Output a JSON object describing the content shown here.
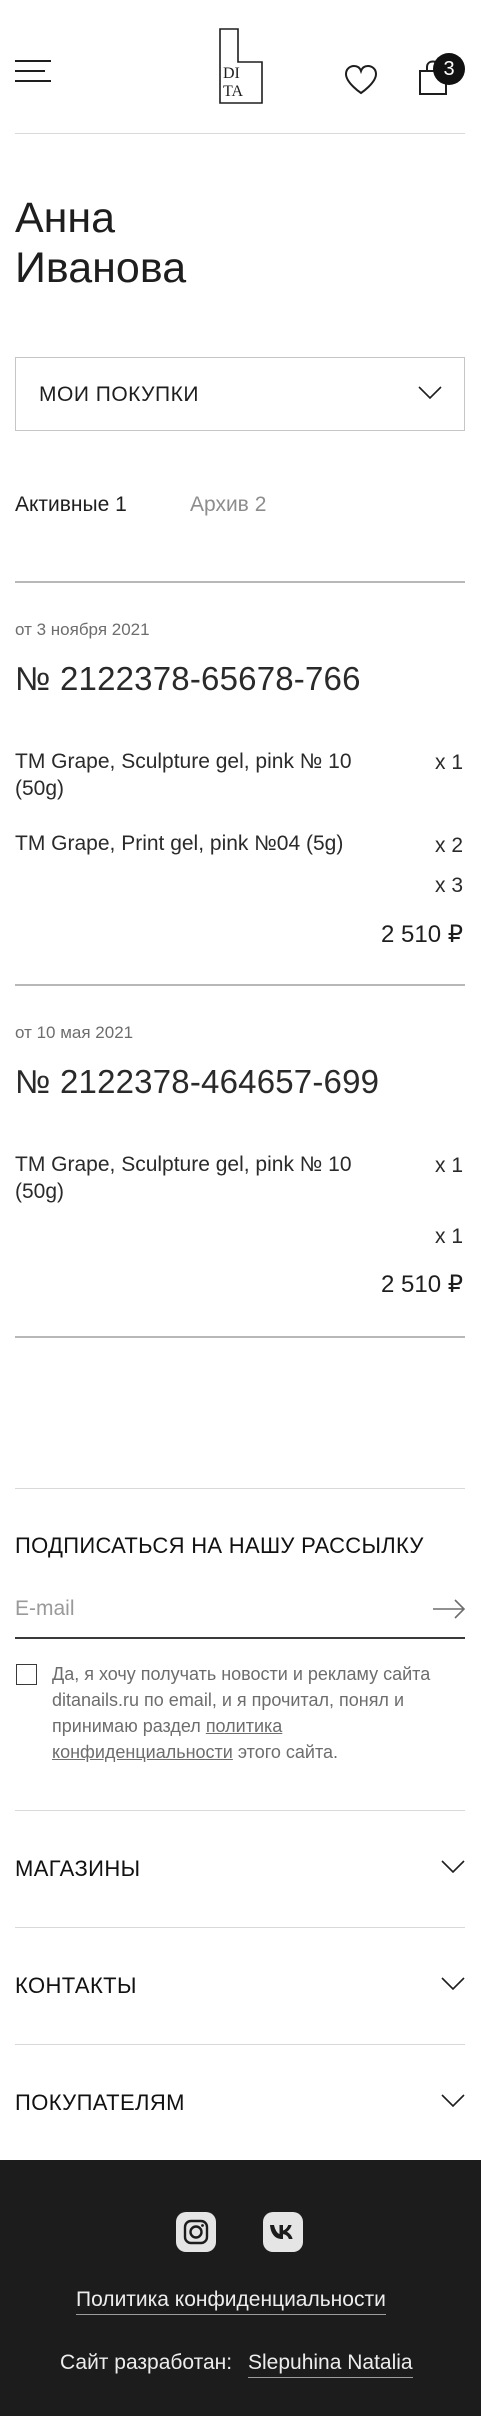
{
  "header": {
    "logo_text_top": "DI",
    "logo_text_bottom": "TA",
    "cart_count": "3"
  },
  "user": {
    "first_name": "Анна",
    "last_name": "Иванова"
  },
  "section_select": {
    "label": "МОИ ПОКУПКИ"
  },
  "tabs": [
    {
      "label": "Активные",
      "count": "1"
    },
    {
      "label": "Архив",
      "count": "2"
    }
  ],
  "orders": [
    {
      "date": "от 3 ноября 2021",
      "number": "№ 2122378-65678-766",
      "items": [
        {
          "name": "TM Grape, Sculpture gel, pink № 10 (50g)",
          "qty": "x 1"
        },
        {
          "name": "TM Grape, Print gel, pink №04 (5g)",
          "qty": "x 2"
        },
        {
          "name": "",
          "qty": "x 3"
        }
      ],
      "total": "2 510 ₽"
    },
    {
      "date": "от 10 мая 2021",
      "number": "№  2122378-464657-699",
      "items": [
        {
          "name": "TM Grape, Sculpture gel, pink № 10 (50g)",
          "qty": "x 1"
        },
        {
          "name": "",
          "qty": "x 1"
        }
      ],
      "total": "2 510 ₽"
    }
  ],
  "subscribe": {
    "title": "ПОДПИСАТЬСЯ НА НАШУ РАССЫЛКУ",
    "placeholder": "E-mail",
    "consent_text": "Да, я хочу получать новости и рекламу сайта ditanails.ru по email, и я прочитал, понял и принимаю раздел",
    "consent_link": "политика конфиденциальности",
    "consent_suffix": "этого сайта."
  },
  "accordions": [
    {
      "label": "МАГАЗИНЫ"
    },
    {
      "label": "КОНТАКТЫ"
    },
    {
      "label": "ПОКУПАТЕЛЯМ"
    }
  ],
  "footer": {
    "social": [
      "instagram-icon",
      "vk-icon"
    ],
    "privacy_link": "Политика конфиденциальности",
    "developer_prefix": "Сайт разработан:",
    "developer_name": "Slepuhina Natalia"
  },
  "colors": {
    "text": "#1e1e1e",
    "muted": "#8d8d8d",
    "footer_bg": "#1c1c1c"
  }
}
